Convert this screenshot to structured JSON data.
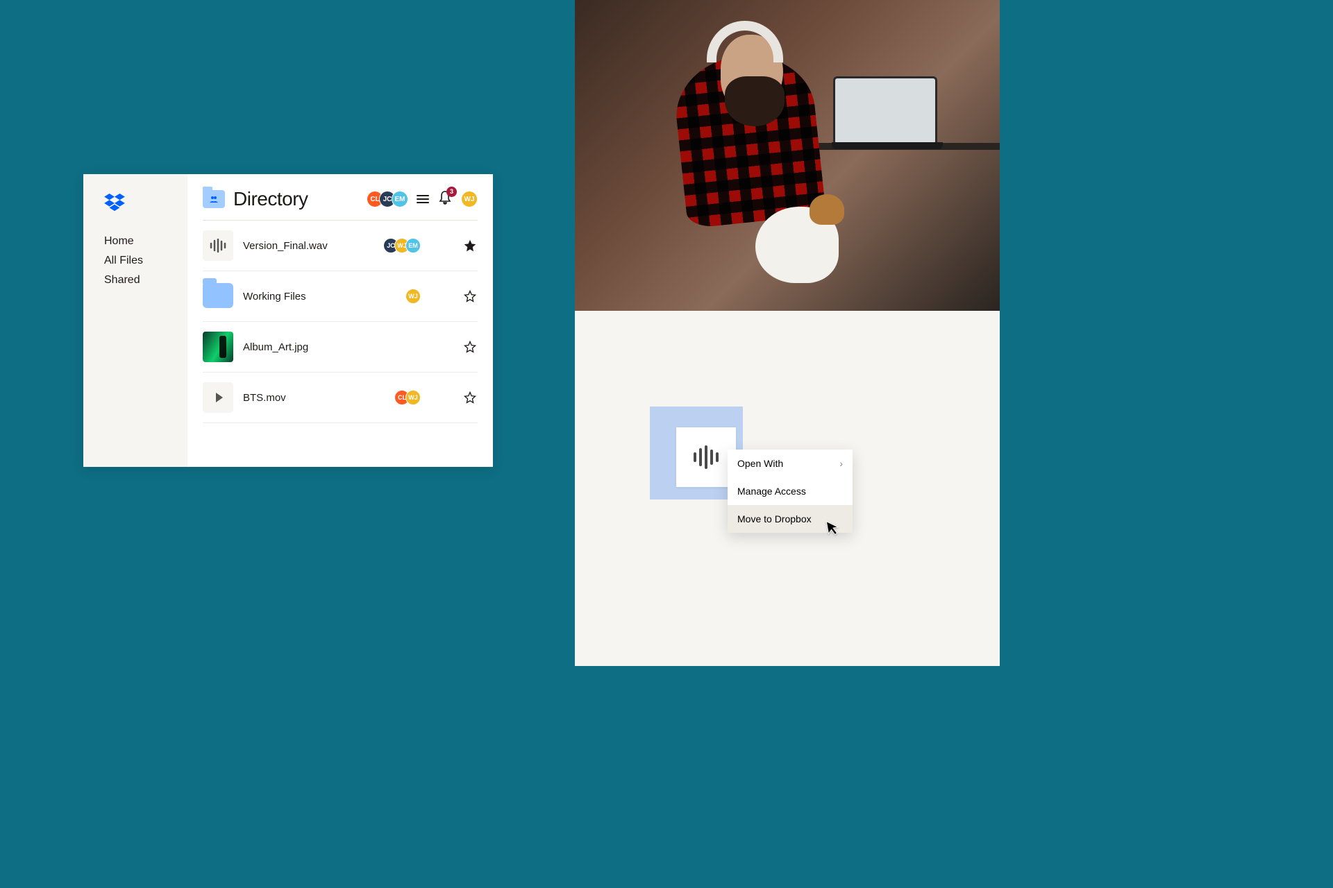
{
  "sidebar": {
    "nav": [
      "Home",
      "All Files",
      "Shared"
    ]
  },
  "header": {
    "title": "Directory",
    "avatars": [
      {
        "initials": "CL",
        "bg": "#ff5a1f"
      },
      {
        "initials": "JC",
        "bg": "#2a3b58"
      },
      {
        "initials": "EM",
        "bg": "#4fc3e8"
      }
    ],
    "notification_count": "3",
    "user_avatar": {
      "initials": "WJ",
      "bg": "#f2b824"
    }
  },
  "files": [
    {
      "name": "Version_Final.wav",
      "type": "audio",
      "avatars": [
        {
          "initials": "JC",
          "bg": "#2a3b58"
        },
        {
          "initials": "WJ",
          "bg": "#f2b824"
        },
        {
          "initials": "EM",
          "bg": "#4fc3e8"
        }
      ],
      "starred": true
    },
    {
      "name": "Working Files",
      "type": "folder",
      "avatars": [
        {
          "initials": "WJ",
          "bg": "#f2b824"
        }
      ],
      "starred": false
    },
    {
      "name": "Album_Art.jpg",
      "type": "image",
      "avatars": [],
      "starred": false
    },
    {
      "name": "BTS.mov",
      "type": "video",
      "avatars": [
        {
          "initials": "CL",
          "bg": "#ff5a1f"
        },
        {
          "initials": "WJ",
          "bg": "#f2b824"
        }
      ],
      "starred": false
    }
  ],
  "context_menu": {
    "items": [
      {
        "label": "Open With",
        "submenu": true,
        "selected": false
      },
      {
        "label": "Manage Access",
        "submenu": false,
        "selected": false
      },
      {
        "label": "Move to Dropbox",
        "submenu": false,
        "selected": true
      }
    ]
  },
  "colors": {
    "background": "#0e6e84",
    "sidebar_bg": "#f7f5f2",
    "dropbox_blue": "#0061ff"
  }
}
